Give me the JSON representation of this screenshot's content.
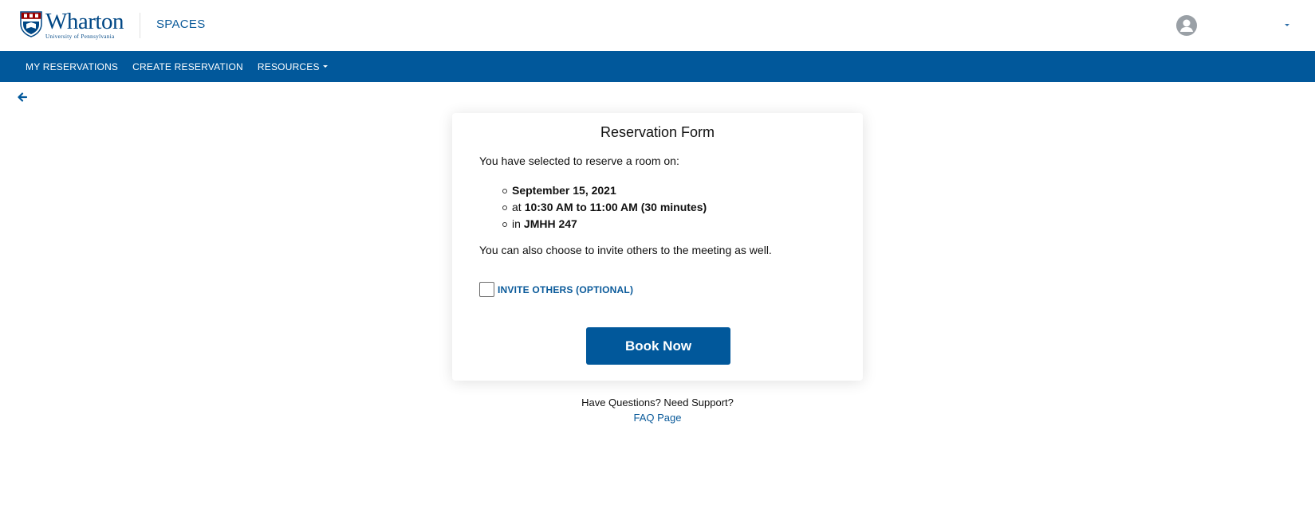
{
  "header": {
    "logo_word": "Wharton",
    "logo_sub": "University of Pennsylvania",
    "app_name": "SPACES"
  },
  "nav": {
    "items": [
      {
        "label": "MY RESERVATIONS"
      },
      {
        "label": "CREATE RESERVATION"
      },
      {
        "label": "RESOURCES"
      }
    ]
  },
  "form": {
    "title": "Reservation Form",
    "intro": "You have selected to reserve a room on:",
    "details": {
      "date": "September 15, 2021",
      "time_prefix": "at",
      "time": "10:30 AM to 11:00 AM (30 minutes)",
      "room_prefix": "in",
      "room": "JMHH 247"
    },
    "invite_note": "You can also choose to invite others to the meeting as well.",
    "invite_checkbox": {
      "label": "INVITE OTHERS (OPTIONAL)",
      "checked": false
    },
    "book_button": "Book Now"
  },
  "footer": {
    "support_text": "Have Questions? Need Support?",
    "faq_link": "FAQ Page"
  },
  "colors": {
    "brand_blue": "#01589b",
    "link_blue": "#0a5a9a",
    "logo_navy": "#004785",
    "logo_red": "#990000"
  },
  "icons": [
    "penn-shield-icon",
    "user-avatar-icon",
    "caret-down-icon",
    "back-arrow-icon"
  ]
}
